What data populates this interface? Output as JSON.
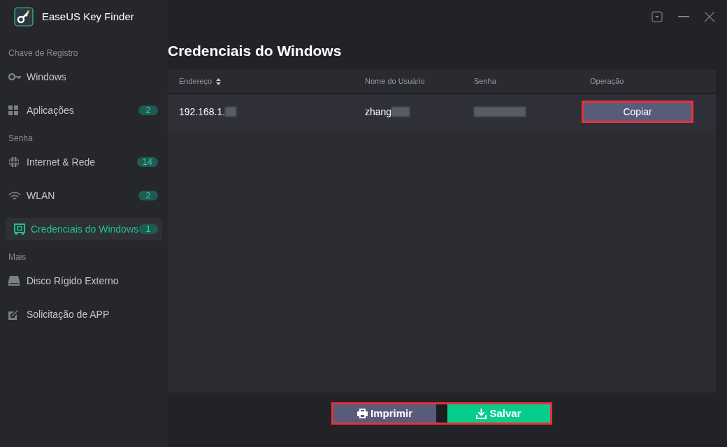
{
  "window": {
    "title": "EaseUS Key Finder"
  },
  "sidebar": {
    "sections": [
      {
        "heading": "Chave de Registro",
        "items": [
          {
            "label": "Windows",
            "selected": false
          },
          {
            "label": "Aplicações",
            "count": "2",
            "selected": false
          }
        ]
      },
      {
        "heading": "Senha",
        "items": [
          {
            "label": "Internet & Rede",
            "count": "14",
            "selected": false
          },
          {
            "label": "WLAN",
            "count": "2",
            "selected": false
          },
          {
            "label": "Credenciais do Windows",
            "count": "1",
            "selected": true
          }
        ]
      },
      {
        "heading": "Mais",
        "items": [
          {
            "label": "Disco Rígido Externo",
            "selected": false
          },
          {
            "label": "Solicitação de APP",
            "selected": false
          }
        ]
      }
    ]
  },
  "page_title": "Credenciais do Windows",
  "table": {
    "columns": [
      "Endereço",
      "Nome do Usuário",
      "Senha",
      "Operação"
    ],
    "rows": [
      {
        "address": "192.168.1.",
        "user": "zhang",
        "action": {
          "label": "Copiar",
          "highlighted": true
        }
      }
    ]
  },
  "footer": {
    "highlighted": true,
    "buttons": [
      {
        "label": "Imprimir"
      },
      {
        "label": "Salvar"
      }
    ]
  }
}
